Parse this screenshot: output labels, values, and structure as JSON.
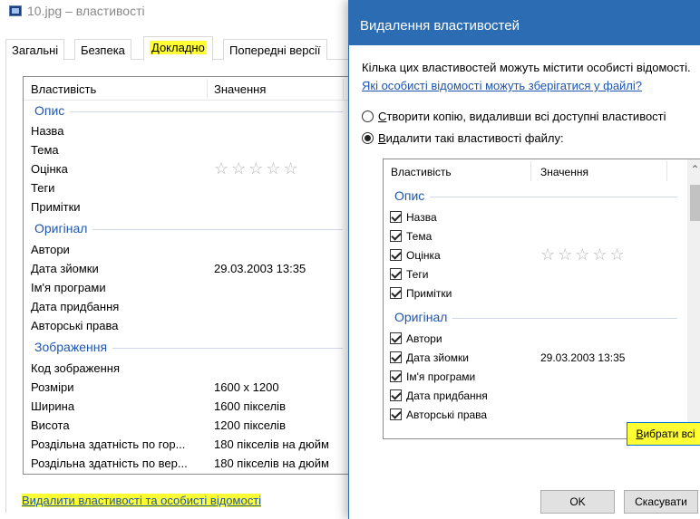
{
  "background_window": {
    "title": "10.jpg – властивості",
    "tabs": [
      {
        "label": "Загальні"
      },
      {
        "label": "Безпека"
      },
      {
        "label": "Докладно"
      },
      {
        "label": "Попередні версії"
      }
    ],
    "list": {
      "col_property": "Властивість",
      "col_value": "Значення",
      "groups": {
        "description": "Опис",
        "origin": "Оригінал",
        "image": "Зображення"
      },
      "rows": {
        "title": {
          "name": "Назва",
          "value": ""
        },
        "subject": {
          "name": "Тема",
          "value": ""
        },
        "rating": {
          "name": "Оцінка",
          "value": "☆☆☆☆☆"
        },
        "tags": {
          "name": "Теги",
          "value": ""
        },
        "comments": {
          "name": "Примітки",
          "value": ""
        },
        "authors": {
          "name": "Автори",
          "value": ""
        },
        "date_taken": {
          "name": "Дата зйомки",
          "value": "29.03.2003 13:35"
        },
        "program": {
          "name": "Ім'я програми",
          "value": ""
        },
        "date_acquired": {
          "name": "Дата придбання",
          "value": ""
        },
        "copyright": {
          "name": "Авторські права",
          "value": ""
        },
        "image_id": {
          "name": "Код зображення",
          "value": ""
        },
        "dimensions": {
          "name": "Розміри",
          "value": "1600 x 1200"
        },
        "width": {
          "name": "Ширина",
          "value": "1600 пікселів"
        },
        "height": {
          "name": "Висота",
          "value": "1200 пікселів"
        },
        "h_res": {
          "name": "Роздільна здатність по гор...",
          "value": "180 пікселів на дюйм"
        },
        "v_res": {
          "name": "Роздільна здатність по вер...",
          "value": "180 пікселів на дюйм"
        }
      }
    },
    "remove_link": "Видалити властивості та особисті відомості"
  },
  "dialog": {
    "title": "Видалення властивостей",
    "info_text": "Кілька цих властивостей можуть містити особисті відомості.",
    "info_link": "Які особисті відомості можуть зберігатися у файлі?",
    "option_copy_prefix": "С",
    "option_copy_rest": "творити копію, видаливши всі доступні властивості",
    "option_remove_prefix": "В",
    "option_remove_rest": "идалити такі властивості файлу:",
    "selected_option": "remove",
    "list": {
      "col_property": "Властивість",
      "col_value": "Значення",
      "groups": {
        "description": "Опис",
        "origin": "Оригінал"
      },
      "rows": {
        "title": {
          "name": "Назва",
          "value": "",
          "checked": true
        },
        "subject": {
          "name": "Тема",
          "value": "",
          "checked": true
        },
        "rating": {
          "name": "Оцінка",
          "value": "☆☆☆☆☆",
          "checked": true
        },
        "tags": {
          "name": "Теги",
          "value": "",
          "checked": true
        },
        "comments": {
          "name": "Примітки",
          "value": "",
          "checked": true
        },
        "authors": {
          "name": "Автори",
          "value": "",
          "checked": true
        },
        "date_taken": {
          "name": "Дата зйомки",
          "value": "29.03.2003 13:35",
          "checked": true
        },
        "program": {
          "name": "Ім'я програми",
          "value": "",
          "checked": true
        },
        "date_acquired": {
          "name": "Дата придбання",
          "value": "",
          "checked": true
        },
        "copyright": {
          "name": "Авторські права",
          "value": "",
          "checked": true
        }
      }
    },
    "select_all_prefix": "В",
    "select_all_rest": "ибрати всі",
    "ok_label": "OK",
    "cancel_label": "Скасувати",
    "colors": {
      "title_bar": "#2b6cb3",
      "highlight": "#ffff33",
      "group_heading": "#1e55b0"
    }
  }
}
